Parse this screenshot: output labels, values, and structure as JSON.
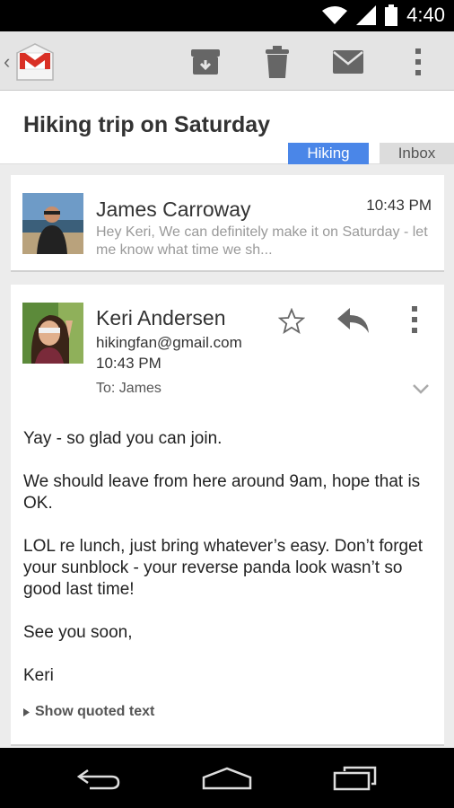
{
  "status_bar": {
    "time": "4:40"
  },
  "thread": {
    "subject": "Hiking trip on Saturday",
    "labels": [
      "Hiking",
      "Inbox"
    ]
  },
  "messages": [
    {
      "sender": "James Carroway",
      "time": "10:43 PM",
      "snippet": "Hey Keri, We can definitely make it on Saturday - let me know what time we sh..."
    },
    {
      "sender": "Keri Andersen",
      "email": "hikingfan@gmail.com",
      "time": "10:43 PM",
      "to": "To: James",
      "body": [
        "Yay - so glad you can join.",
        "We should leave from here around 9am, hope that is OK.",
        "LOL re lunch, just bring whatever’s easy. Don’t forget your sunblock - your reverse panda look wasn’t so good last time!",
        "See you soon,",
        "Keri"
      ],
      "show_quoted": "Show quoted text"
    }
  ],
  "colors": {
    "label_hiking": "#4a86e8",
    "gmail_red": "#d93025"
  }
}
